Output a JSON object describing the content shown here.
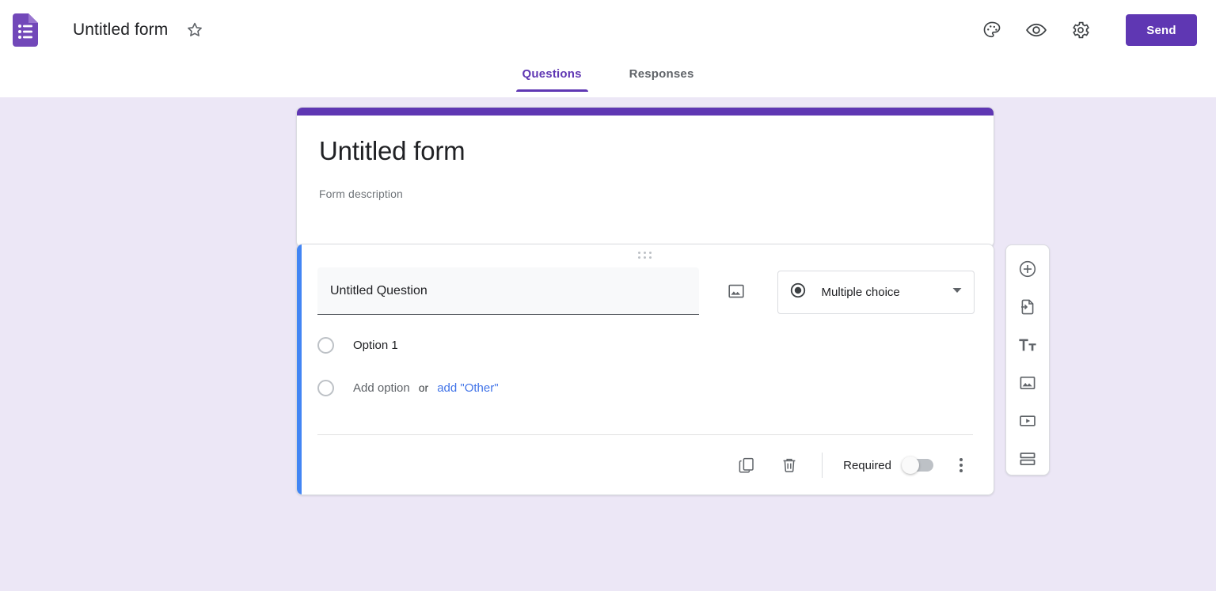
{
  "app": {
    "logo_icon": "google-forms-logo-icon",
    "title": "Untitled form",
    "star_icon": "star-outline-icon"
  },
  "toolbar": {
    "theme_icon": "palette-icon",
    "preview_icon": "eye-icon",
    "settings_icon": "gear-icon",
    "send_label": "Send"
  },
  "tabs": [
    {
      "label": "Questions",
      "active": true
    },
    {
      "label": "Responses",
      "active": false
    }
  ],
  "form_header": {
    "title": "Untitled form",
    "description": "Form description",
    "band_color": "#5f37b3"
  },
  "question": {
    "accent_color": "#4285f4",
    "drag_handle_icon": "drag-handle-icon",
    "title": "Untitled Question",
    "image_icon": "image-icon",
    "type": {
      "icon": "radio-filled-icon",
      "label": "Multiple choice",
      "chevron_icon": "chevron-down-icon"
    },
    "options": [
      {
        "label": "Option 1"
      }
    ],
    "add_option": {
      "label": "Add option",
      "or_label": "or",
      "other_label": "add \"Other\""
    },
    "footer": {
      "duplicate_icon": "duplicate-icon",
      "delete_icon": "trash-icon",
      "required_label": "Required",
      "required_on": false,
      "more_icon": "more-vertical-icon"
    }
  },
  "side_toolbar": [
    {
      "icon": "add-question-icon",
      "name": "add-question"
    },
    {
      "icon": "import-questions-icon",
      "name": "import-questions"
    },
    {
      "icon": "add-title-icon",
      "name": "add-title-and-description"
    },
    {
      "icon": "add-image-icon",
      "name": "add-image"
    },
    {
      "icon": "add-video-icon",
      "name": "add-video"
    },
    {
      "icon": "add-section-icon",
      "name": "add-section"
    }
  ],
  "colors": {
    "background": "#ece7f6",
    "brand_purple": "#5f37b3",
    "accent_blue": "#4285f4",
    "link_blue": "#4274e8"
  }
}
